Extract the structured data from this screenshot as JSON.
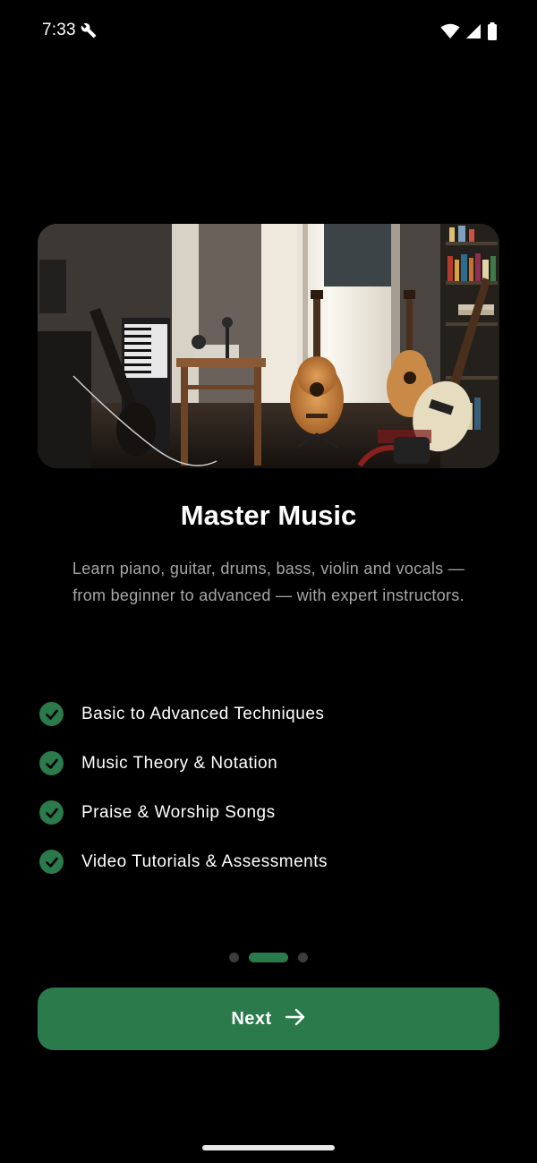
{
  "status_bar": {
    "time": "7:33",
    "icons": [
      "wrench-icon",
      "wifi-icon",
      "signal-icon",
      "battery-icon"
    ]
  },
  "hero": {
    "image": "music-room-photo"
  },
  "onboarding": {
    "title": "Master Music",
    "subtitle": "Learn piano, guitar, drums, bass, violin and vocals — from beginner to advanced — with expert instructors.",
    "features": [
      {
        "label": "Basic to Advanced Techniques",
        "icon": "check-circle-icon"
      },
      {
        "label": "Music Theory & Notation",
        "icon": "check-circle-icon"
      },
      {
        "label": "Praise & Worship Songs",
        "icon": "check-circle-icon"
      },
      {
        "label": "Video Tutorials & Assessments",
        "icon": "check-circle-icon"
      }
    ],
    "page_indicator": {
      "total": 3,
      "current": 2
    },
    "next_button": {
      "label": "Next",
      "icon": "arrow-right-icon"
    }
  },
  "colors": {
    "background": "#000000",
    "accent": "#2b7a4b",
    "subtitle_text": "#a7a7a7",
    "inactive_dot": "#3c3c3c"
  }
}
